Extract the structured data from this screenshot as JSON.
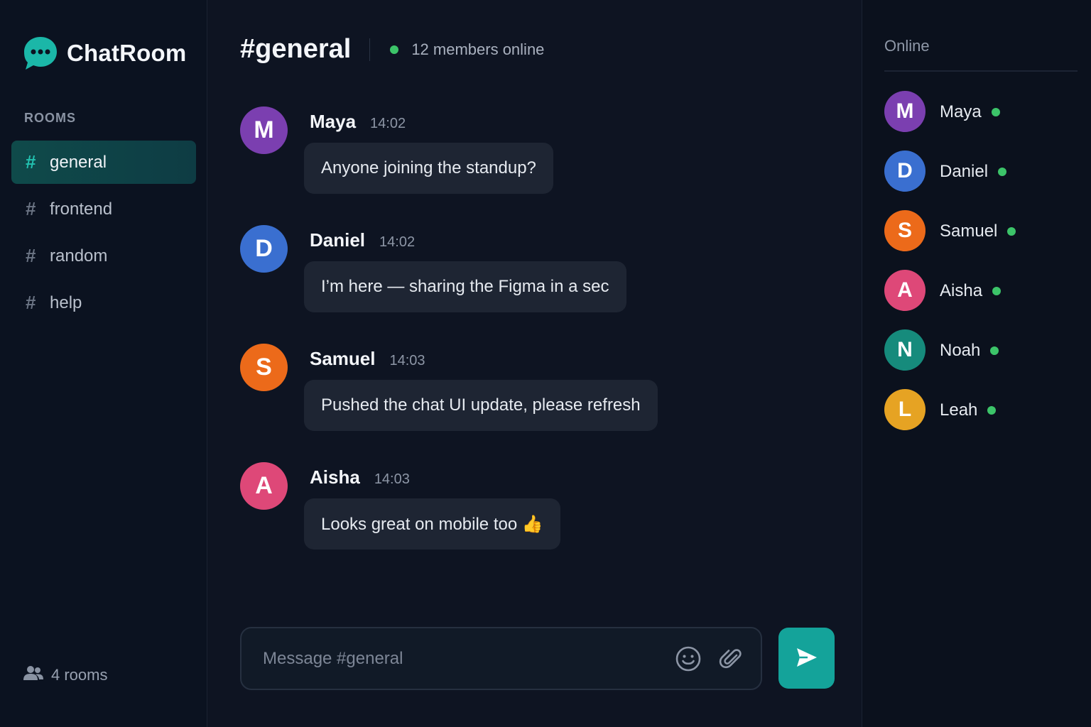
{
  "app": {
    "title": "ChatRoom"
  },
  "sidebar": {
    "rooms_heading": "ROOMS",
    "rooms": [
      {
        "name": "general",
        "active": true
      },
      {
        "name": "frontend",
        "active": false
      },
      {
        "name": "random",
        "active": false
      },
      {
        "name": "help",
        "active": false
      }
    ],
    "rooms_count": "4 rooms"
  },
  "channel": {
    "title": "#general",
    "members_online": "12 members online"
  },
  "messages": [
    {
      "author": "Maya",
      "initial": "M",
      "time": "14:02",
      "text": "Anyone joining the standup?",
      "color": "#7b3fb0"
    },
    {
      "author": "Daniel",
      "initial": "D",
      "time": "14:02",
      "text": "I’m here — sharing the Figma in a sec",
      "color": "#3a6fd0"
    },
    {
      "author": "Samuel",
      "initial": "S",
      "time": "14:03",
      "text": "Pushed the chat UI update, please refresh",
      "color": "#ec6a1a"
    },
    {
      "author": "Aisha",
      "initial": "A",
      "time": "14:03",
      "text": "Looks great on mobile too 👍",
      "color": "#de4878"
    }
  ],
  "composer": {
    "placeholder": "Message #general"
  },
  "online": {
    "heading": "Online",
    "members": [
      {
        "name": "Maya",
        "initial": "M",
        "color": "#7b3fb0"
      },
      {
        "name": "Daniel",
        "initial": "D",
        "color": "#3a6fd0"
      },
      {
        "name": "Samuel",
        "initial": "S",
        "color": "#ec6a1a"
      },
      {
        "name": "Aisha",
        "initial": "A",
        "color": "#de4878"
      },
      {
        "name": "Noah",
        "initial": "N",
        "color": "#168b7c"
      },
      {
        "name": "Leah",
        "initial": "L",
        "color": "#e6a323"
      }
    ]
  },
  "colors": {
    "accent": "#14a39a",
    "online": "#3cc469"
  },
  "icons": {
    "logo": "chat-bubble-icon",
    "room": "hash-icon",
    "rooms_count": "people-icon",
    "emoji": "smiley-icon",
    "attach": "paperclip-icon",
    "send": "send-icon"
  }
}
